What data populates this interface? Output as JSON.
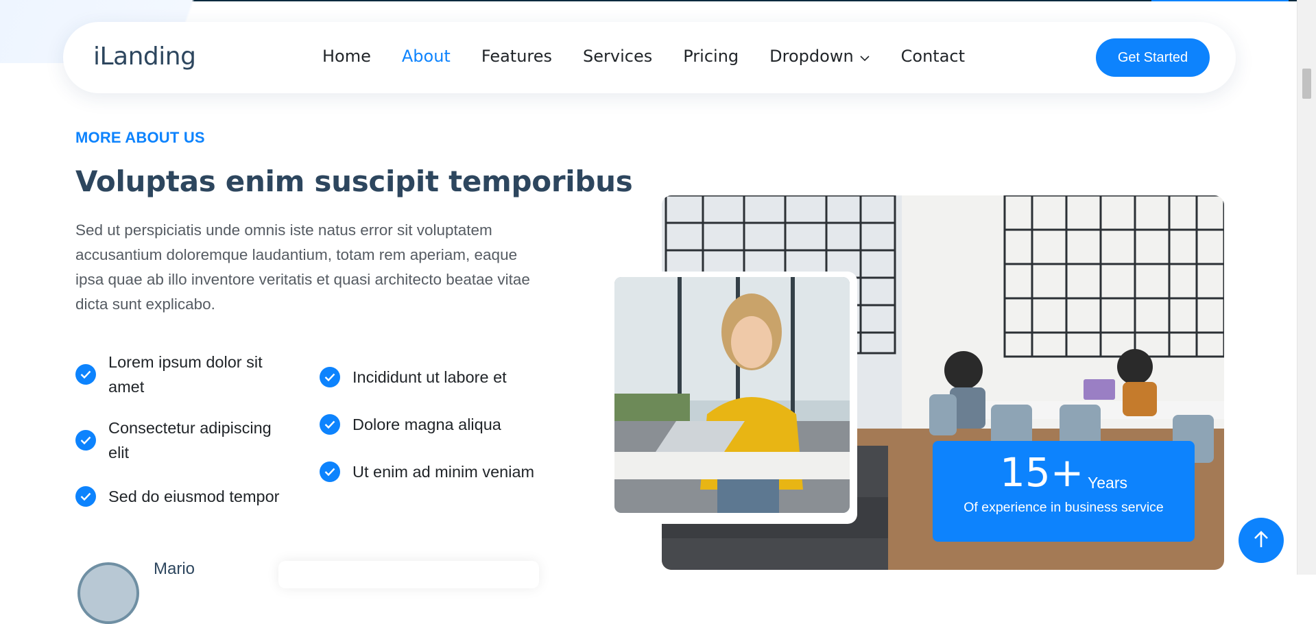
{
  "header": {
    "logo": "iLanding",
    "nav": [
      {
        "label": "Home"
      },
      {
        "label": "About",
        "active": true
      },
      {
        "label": "Features"
      },
      {
        "label": "Services"
      },
      {
        "label": "Pricing"
      },
      {
        "label": "Dropdown",
        "has_chevron": true
      },
      {
        "label": "Contact"
      }
    ],
    "cta_label": "Get Started"
  },
  "about": {
    "eyebrow": "MORE ABOUT US",
    "title": "Voluptas enim suscipit temporibus",
    "description": "Sed ut perspiciatis unde omnis iste natus error sit voluptatem accusantium doloremque laudantium, totam rem aperiam, eaque ipsa quae ab illo inventore veritatis et quasi architecto beatae vitae dicta sunt explicabo.",
    "features_col1": [
      "Lorem ipsum dolor sit amet",
      "Consectetur adipiscing elit",
      "Sed do eiusmod tempor"
    ],
    "features_col2": [
      "Incididunt ut labore et",
      "Dolore magna aliqua",
      "Ut enim ad minim veniam"
    ],
    "profile_name": "Mario"
  },
  "experience": {
    "number": "15+",
    "unit": "Years",
    "caption": "Of experience in business service"
  },
  "colors": {
    "accent": "#0d83fd",
    "heading": "#2d465e",
    "body_text": "#555b62"
  },
  "icons": [
    "check-circle-icon",
    "chevron-down-icon",
    "arrow-up-icon"
  ]
}
